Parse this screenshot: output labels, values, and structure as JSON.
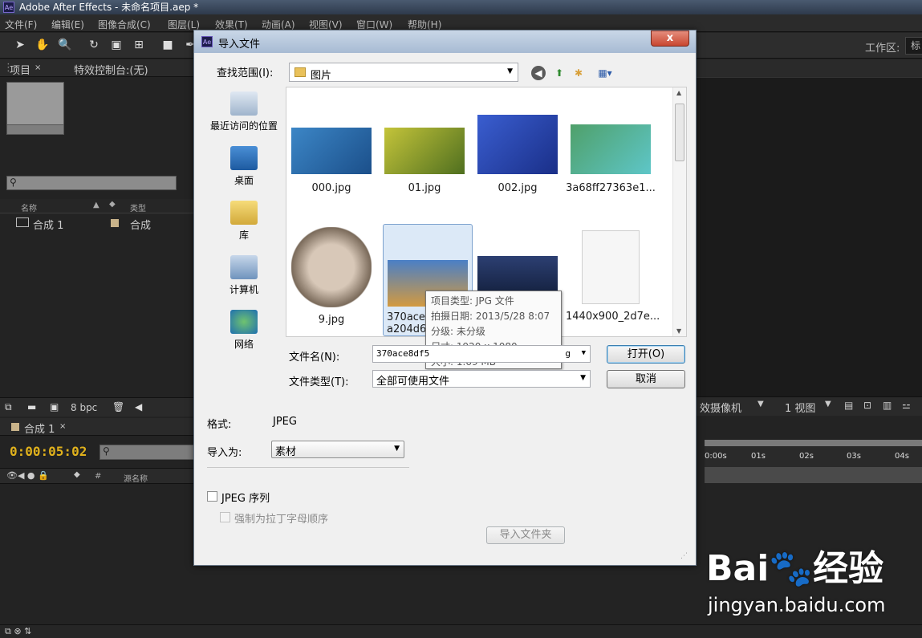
{
  "app": {
    "title": "Adobe After Effects - 未命名项目.aep *",
    "menu": [
      "文件(F)",
      "编辑(E)",
      "图像合成(C)",
      "图层(L)",
      "效果(T)",
      "动画(A)",
      "视图(V)",
      "窗口(W)",
      "帮助(H)"
    ],
    "workspace_label": "工作区:",
    "workspace_value": "标"
  },
  "project_panel": {
    "tab_project": "项目",
    "tab_effects": "特效控制台:(无)",
    "col_name": "名称",
    "col_type": "类型",
    "item_name": "合成 1",
    "item_type": "合成",
    "bpc": "8 bpc"
  },
  "timeline": {
    "tab": "合成 1",
    "timecode": "0:00:05:02",
    "col_source": "源名称",
    "ruler": [
      "0:00s",
      "01s",
      "02s",
      "03s",
      "04s"
    ]
  },
  "viewer_controls": {
    "camera": "效摄像机",
    "views": "1 视图"
  },
  "dialog": {
    "title": "导入文件",
    "close": "x",
    "look_in_label": "查找范围(I):",
    "look_in_value": "图片",
    "places": [
      "最近访问的位置",
      "桌面",
      "库",
      "计算机",
      "网络"
    ],
    "files": [
      {
        "name": "000.jpg",
        "color": "#2d6aa8"
      },
      {
        "name": "01.jpg",
        "color": "#6f8a2a"
      },
      {
        "name": "002.jpg",
        "color": "#2a46b0"
      },
      {
        "name": "3a68ff27363e1...",
        "color": "#3f8f5a"
      },
      {
        "name": "9.jpg",
        "color": "#8a7a6a"
      },
      {
        "name": "370ace8df5...",
        "name2": "a204d6...",
        "color": "#c98a3a"
      },
      {
        "name": "...",
        "color": "#24335a"
      },
      {
        "name": "1440x900_2d7e...",
        "color": "#f2f2f2"
      }
    ],
    "tooltip": {
      "type": "项目类型: JPG 文件",
      "date": "拍摄日期: 2013/5/28 8:07",
      "rating": "分级: 未分级",
      "size_dim": "尺寸: 1920 x 1080",
      "size": "大小: 1.69 MB"
    },
    "filename_label": "文件名(N):",
    "filename_value": "370ace8df5",
    "filename_ext": "g",
    "filetype_label": "文件类型(T):",
    "filetype_value": "全部可使用文件",
    "open_button": "打开(O)",
    "cancel_button": "取消",
    "format_label": "格式:",
    "format_value": "JPEG",
    "import_as_label": "导入为:",
    "import_as_value": "素材",
    "sequence_label": "JPEG 序列",
    "force_alpha_label": "强制为拉丁字母顺序",
    "import_folder_button": "导入文件夹"
  },
  "watermark": {
    "text1": "Bai",
    "text2": "经验",
    "text3": "jingyan.baidu.com"
  }
}
